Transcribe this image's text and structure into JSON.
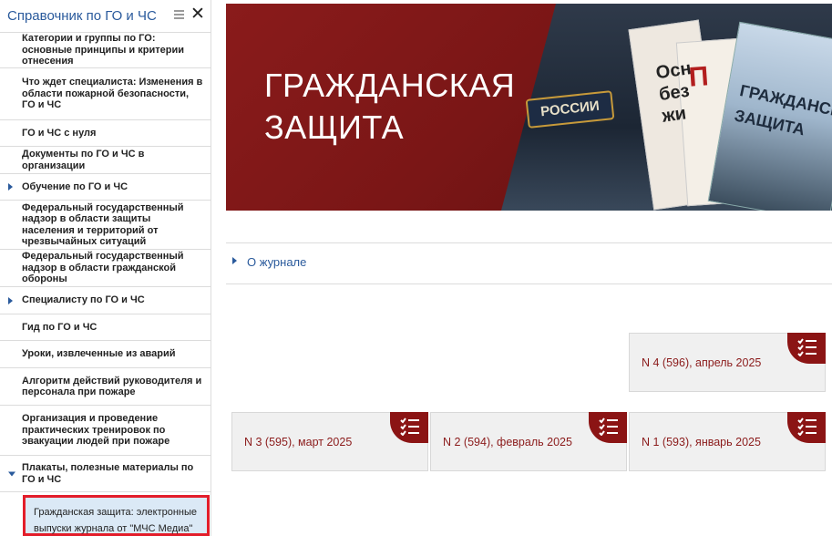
{
  "sidebar": {
    "title": "Справочник по ГО и ЧС",
    "menu_icon": "hamburger-icon",
    "close_icon": "close-icon",
    "items": [
      {
        "label": "Категории и группы по ГО: основные принципы и критерии отнесения",
        "arrow": "none"
      },
      {
        "label": "Что ждет специалиста: Изменения в области пожарной безопасности, ГО и ЧС",
        "arrow": "none"
      },
      {
        "label": "ГО и ЧС с нуля",
        "arrow": "none"
      },
      {
        "label": "Документы по ГО и ЧС в организации",
        "arrow": "none"
      },
      {
        "label": "Обучение по ГО и ЧС",
        "arrow": "right"
      },
      {
        "label": "Федеральный государственный надзор в области защиты населения и территорий от чрезвычайных ситуаций",
        "arrow": "none"
      },
      {
        "label": "Федеральный государственный надзор в области гражданской обороны",
        "arrow": "none"
      },
      {
        "label": "Специалисту по ГО и ЧС",
        "arrow": "right"
      },
      {
        "label": "Гид по ГО и ЧС",
        "arrow": "none"
      },
      {
        "label": "Уроки, извлеченные из аварий",
        "arrow": "none"
      },
      {
        "label": "Алгоритм действий руководителя и персонала при пожаре",
        "arrow": "none"
      },
      {
        "label": "Организация и проведение практических тренировок по эвакуации людей при пожаре",
        "arrow": "none"
      },
      {
        "label": "Плакаты, полезные материалы по ГО и ЧС",
        "arrow": "down"
      }
    ],
    "subitem": {
      "label": "Гражданская защита: электронные выпуски журнала от \"МЧС Медиа\"",
      "selected": true
    }
  },
  "banner": {
    "title_line1": "ГРАЖДАНСКАЯ",
    "title_line2": "ЗАЩИТА",
    "patch_text": "РОССИИ",
    "magazine_text_1": "Осн без жи",
    "magazine_text_2": "П",
    "magazine_text_3": "ГРАЖДАНСКАЯ ЗАЩИТА",
    "colors": {
      "background": "#7a1616",
      "title": "#ffffff"
    }
  },
  "about": {
    "label": "О журнале"
  },
  "issues": [
    {
      "label": "N 4 (596), апрель 2025",
      "icon": "checklist-icon"
    },
    {
      "label": "N 3 (595), март 2025",
      "icon": "checklist-icon"
    },
    {
      "label": "N 2 (594), февраль 2025",
      "icon": "checklist-icon"
    },
    {
      "label": "N 1 (593), январь 2025",
      "icon": "checklist-icon"
    }
  ],
  "colors": {
    "accent_blue": "#2a5a9c",
    "accent_red": "#8b1414",
    "selection_border": "#e31d2a"
  }
}
